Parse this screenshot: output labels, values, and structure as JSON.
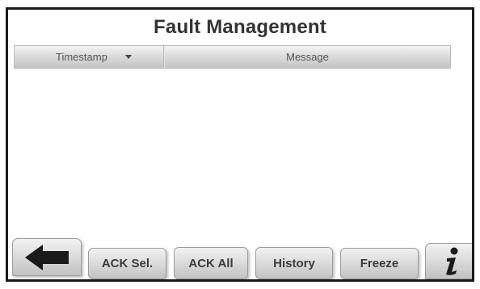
{
  "window": {
    "title": "Fault Management"
  },
  "grid": {
    "columns": [
      {
        "label": "Timestamp",
        "sort": "descending"
      },
      {
        "label": "Message"
      }
    ],
    "rows": []
  },
  "toolbar": {
    "back_icon": "left-arrow-icon",
    "ack_sel_label": "ACK Sel.",
    "ack_all_label": "ACK All",
    "history_label": "History",
    "freeze_label": "Freeze",
    "info_icon": "info-icon"
  }
}
